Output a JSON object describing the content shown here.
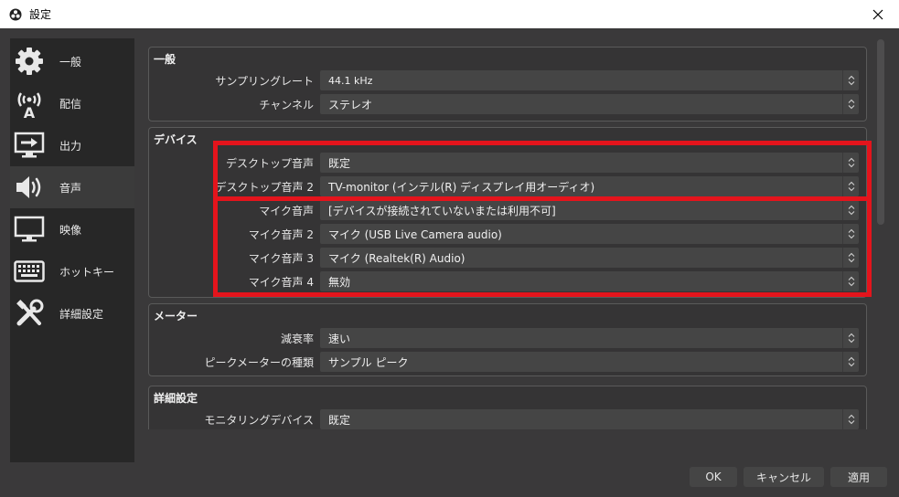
{
  "window": {
    "title": "設定",
    "app_icon": "obs-icon",
    "close_glyph": "✕"
  },
  "sidebar": {
    "items": [
      {
        "label": "一般",
        "icon": "gear-icon"
      },
      {
        "label": "配信",
        "icon": "broadcast-tower-icon"
      },
      {
        "label": "出力",
        "icon": "output-monitor-icon"
      },
      {
        "label": "音声",
        "icon": "speaker-icon",
        "selected": true
      },
      {
        "label": "映像",
        "icon": "display-icon"
      },
      {
        "label": "ホットキー",
        "icon": "keyboard-icon"
      },
      {
        "label": "詳細設定",
        "icon": "tools-icon"
      }
    ]
  },
  "sections": {
    "general": {
      "title": "一般",
      "rows": [
        {
          "label": "サンプリングレート",
          "value": "44.1 kHz"
        },
        {
          "label": "チャンネル",
          "value": "ステレオ"
        }
      ]
    },
    "devices": {
      "title": "デバイス",
      "rows": [
        {
          "label": "デスクトップ音声",
          "value": "既定"
        },
        {
          "label": "デスクトップ音声 2",
          "value": "TV-monitor (インテル(R) ディスプレイ用オーディオ)"
        },
        {
          "label": "マイク音声",
          "value": "[デバイスが接続されていないまたは利用不可]"
        },
        {
          "label": "マイク音声 2",
          "value": "マイク (USB Live Camera audio)"
        },
        {
          "label": "マイク音声 3",
          "value": "マイク (Realtek(R) Audio)"
        },
        {
          "label": "マイク音声 4",
          "value": "無効"
        }
      ]
    },
    "meters": {
      "title": "メーター",
      "rows": [
        {
          "label": "減衰率",
          "value": "速い"
        },
        {
          "label": "ピークメーターの種類",
          "value": "サンプル ピーク"
        }
      ]
    },
    "advanced": {
      "title": "詳細設定",
      "rows": [
        {
          "label": "モニタリングデバイス",
          "value": "既定"
        }
      ]
    }
  },
  "buttons": {
    "ok": "OK",
    "cancel": "キャンセル",
    "apply": "適用"
  },
  "colors": {
    "background": "#3a393a",
    "sidebar": "#272727",
    "highlight": "#e4141c"
  }
}
